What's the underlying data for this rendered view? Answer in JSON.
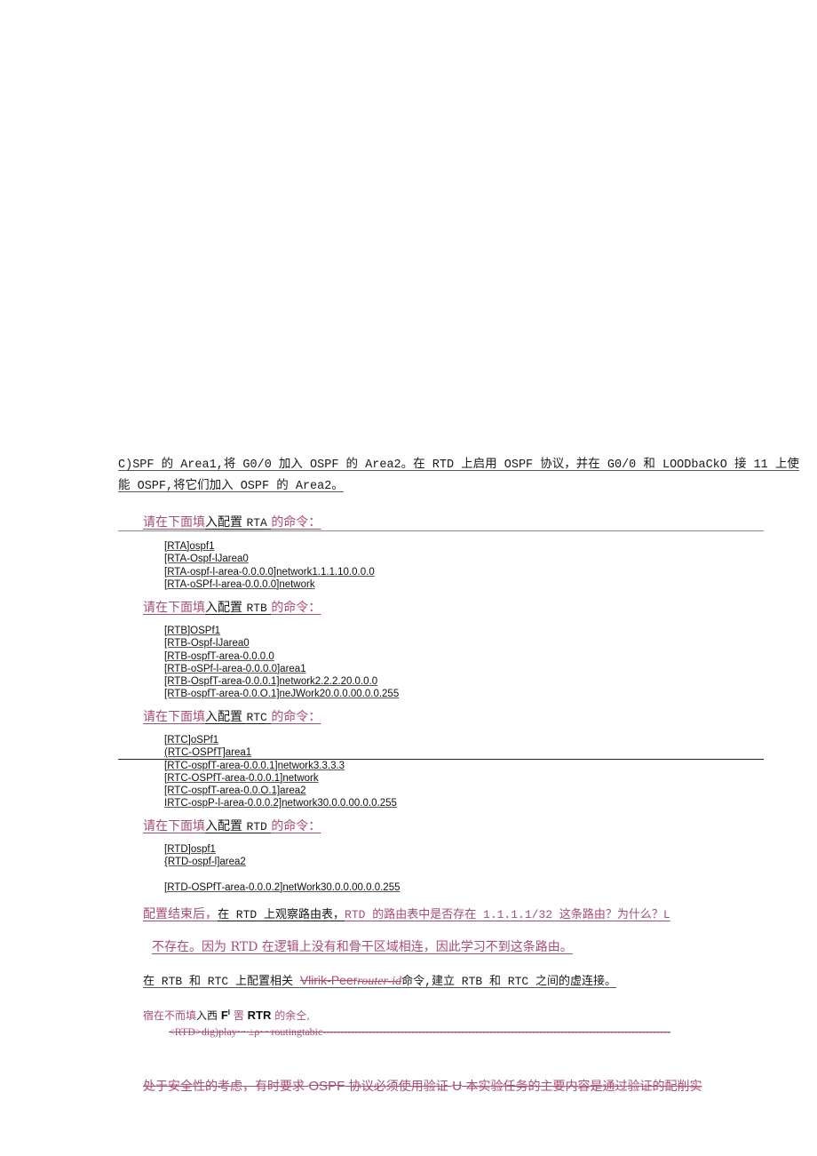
{
  "intro": {
    "line1": "C)SPF 的 Area1,将 G0/0 加入 OSPF 的 Area2。在 RTD 上启用 OSPF 协议，并在 G0/0 和 LOODbaCkO 接 11 上使",
    "line2": "能 OSPF,将它们加入 OSPF 的 Area2。"
  },
  "sections": [
    {
      "prompt_prefix": "请在下面填",
      "prompt_mid": "入配置",
      "router": "RTA",
      "prompt_suffix": "的命令：",
      "commands": [
        "[RTA]ospf1",
        "[RTA-Ospf-lJarea0",
        "[RTA-ospf-l-area-0.0.0.0]network1.1.1.10.0.0.0",
        "[RTA-oSPf-l-area-0.0.0.0]network"
      ]
    },
    {
      "prompt_prefix": "请在下面填",
      "prompt_mid": "入配置",
      "router": "RTB",
      "prompt_suffix": "的命令：",
      "commands": [
        "[RTB]OSPf1",
        "[RTB-Ospf-lJarea0",
        "[RTB-ospfT-area-0.0.0.0",
        "[RTB-oSPf-l-area-0.0.0.0]area1",
        "[RTB-OspfT-area-0.0.0.1]network2.2.2.20.0.0.0",
        "[RTB-ospfT-area-0.0.O.1]neJWork20.0.0.00.0.0.255"
      ]
    },
    {
      "prompt_prefix": "请在下面填",
      "prompt_mid": "入配置",
      "router": "RTC",
      "prompt_suffix": "的命令：",
      "commands": [
        "[RTC]oSPf1",
        "(RTC-OSPfT]area1",
        "[RTC-ospfT-area-0.0.0.1]network3.3.3.3",
        "[RTC-OSPfT-area-0.0.0.1]network",
        "[RTC-ospfT-area-0.0.O.1]area2",
        "IRTC-ospP-l-area-0.0.0.2]network30.0.0.00.0.0.255"
      ]
    },
    {
      "prompt_prefix": "请在下面填",
      "prompt_mid": "入配置",
      "router": "RTD",
      "prompt_suffix": "的命令：",
      "commands": [
        "[RTD]ospf1",
        "{RTD-ospf-l]area2",
        "",
        "[RTD-OSPfT-area-0.0.0.2]netWork30.0.0.00.0.0.255"
      ]
    }
  ],
  "question": {
    "part1": "配置结束后，",
    "part2": "在 RTD 上观察路由表，",
    "part3": "RTD 的路由表中是否存在 1.1.1.1/32 这条路由？为什么？L"
  },
  "answer": "不存在。因为 RTD 在逻辑上没有和骨干区域相连，因此学习不到这条路由。",
  "vlink": {
    "prefix": "在 RTB 和 RTC 上配置相关 ",
    "struck1": "Vlirik-Peer",
    "struck2": "router-id",
    "suffix": "命令,建立 RTB 和 RTC 之间的虚连接。"
  },
  "rtr_prompt": {
    "part1": "宿在不而填",
    "part2": "入西 ",
    "bold1": "F",
    "sup": "I",
    "part3": " 罟 ",
    "bold2": "RTR",
    "part4": " 的余仝,"
  },
  "display_cmd": "<RTD>dig)play~~±ρ~~routingtabic--------------------------------------------------------------------------------------------------",
  "security": {
    "part1": "处于安全性的考虑，有时要求 ",
    "ospf": "OSPF",
    "part2": " 协议必须使用验证 ",
    "u": "U",
    "part3": " 本实验任务的主要内容是通过验证的配削实"
  },
  "colors": {
    "accent_pink": "#b04a72",
    "text": "#1a1a1a"
  }
}
